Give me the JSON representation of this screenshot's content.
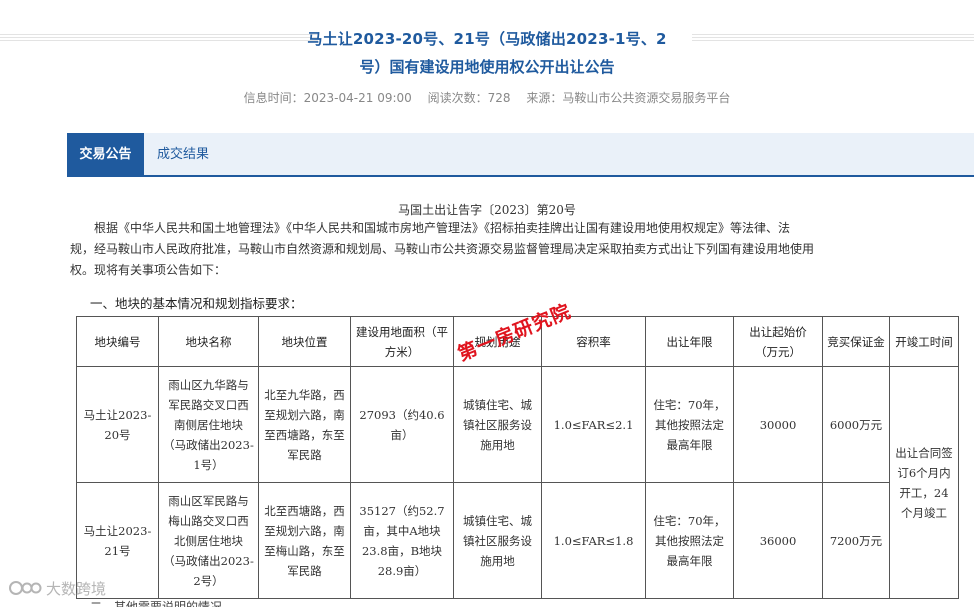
{
  "page": {
    "title_line1": "马土让2023-20号、21号（马政储出2023-1号、2",
    "title_line2": "号）国有建设用地使用权公开出让公告",
    "meta": {
      "info_time": "信息时间：2023-04-21 09:00",
      "read_count": "阅读次数：728",
      "source": "来源：马鞍山市公共资源交易服务平台"
    }
  },
  "tabs": [
    {
      "label": "交易公告",
      "active": true
    },
    {
      "label": "成交结果",
      "active": false
    }
  ],
  "content": {
    "doc_number": "马国土出让告字〔2023〕第20号",
    "intro_lines": [
      "根据《中华人民共和国土地管理法》《中华人民共和国城市房地产管理法》《招标拍卖挂牌出让国有建设用地使用权规定》等法律、法",
      "规，经马鞍山市人民政府批准，马鞍山市自然资源和规划局、马鞍山市公共资源交易监督管理局决定采取拍卖方式出让下列国有建设用地使用",
      "权。现将有关事项公告如下："
    ],
    "section1_title": "一、地块的基本情况和规划指标要求：",
    "table": {
      "headers": {
        "parcel_no": "地块编号",
        "parcel_name": "地块名称",
        "location": "地块位置",
        "area": "建设用地面积（平方米）",
        "use": "规划用途",
        "far": "容积率",
        "term": "出让年限",
        "start_price": "出让起始价（万元）",
        "deposit": "竞买保证金",
        "start_finish": "开竣工时间"
      },
      "rows": [
        {
          "parcel_no": "马土让2023-20号",
          "parcel_name": "雨山区九华路与军民路交叉口西南侧居住地块（马政储出2023-1号）",
          "location": "北至九华路，西至规划六路，南至西塘路，东至军民路",
          "area": "27093（约40.6亩）",
          "use": "城镇住宅、城镇社区服务设施用地",
          "far": "1.0≤FAR≤2.1",
          "term": "住宅：70年，其他按照法定最高年限",
          "start_price": "30000",
          "deposit": "6000万元"
        },
        {
          "parcel_no": "马土让2023-21号",
          "parcel_name": "雨山区军民路与梅山路交叉口西北侧居住地块（马政储出2023-2号）",
          "location": "北至西塘路，西至规划六路，南至梅山路，东至军民路",
          "area": "35127（约52.7亩，其中A地块23.8亩，B地块28.9亩）",
          "use": "城镇住宅、城镇社区服务设施用地",
          "far": "1.0≤FAR≤1.8",
          "term": "住宅：70年，其他按照法定最高年限",
          "start_price": "36000",
          "deposit": "7200万元"
        }
      ],
      "start_finish_merged": "出让合同签订6个月内开工，24个月竣工"
    },
    "stamp_text": "第一房研究院",
    "watermark_text": "大数跨境",
    "bottom_partial": "二、其他需要说明的情况"
  },
  "colors": {
    "title_blue": "#1f5a9e",
    "tab_bg": "#eaf1f9",
    "stamp_red": "#e0141e"
  }
}
